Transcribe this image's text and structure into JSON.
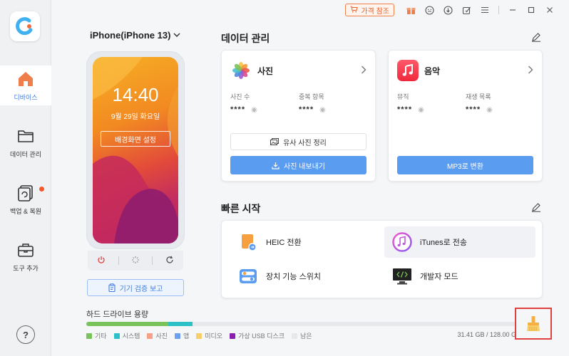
{
  "titlebar": {
    "price_label": "가격 참조"
  },
  "sidebar": {
    "items": [
      {
        "label": "디바이스",
        "icon": "home-icon"
      },
      {
        "label": "데이터 관리",
        "icon": "folder-icon"
      },
      {
        "label": "백업 & 복원",
        "icon": "backup-restore-icon"
      },
      {
        "label": "도구 추가",
        "icon": "toolbox-icon"
      }
    ],
    "help_label": "?"
  },
  "device": {
    "name": "iPhone(iPhone 13)",
    "time": "14:40",
    "date": "9월 29일 화요일",
    "wallpaper_label": "배경화면 설정",
    "verify_label": "기기 검증 보고"
  },
  "data_management": {
    "title": "데이터 관리",
    "photos": {
      "title": "사진",
      "stat1_label": "사진 수",
      "stat1_value": "****",
      "stat2_label": "중복 항목",
      "stat2_value": "****",
      "btn_similar": "유사 사진 정리",
      "btn_export": "사진 내보내기"
    },
    "music": {
      "title": "음악",
      "stat1_label": "뮤직",
      "stat1_value": "****",
      "stat2_label": "재생 목록",
      "stat2_value": "****",
      "btn_convert": "MP3로 변환"
    }
  },
  "quick_start": {
    "title": "빠른 시작",
    "items": [
      {
        "label": "HEIC 전환"
      },
      {
        "label": "iTunes로 전송"
      },
      {
        "label": "장치 기능 스위치"
      },
      {
        "label": "개발자 모드"
      }
    ]
  },
  "storage": {
    "title": "하드 드라이브 용량",
    "capacity": "31.41 GB / 128.00 GB",
    "legend": [
      {
        "label": "기타",
        "color": "#7ac35a"
      },
      {
        "label": "시스템",
        "color": "#2cc1c7"
      },
      {
        "label": "사진",
        "color": "#f6a08a"
      },
      {
        "label": "앱",
        "color": "#6f9ff0"
      },
      {
        "label": "미디오",
        "color": "#f6cf6a"
      },
      {
        "label": "가상 USB 디스크",
        "color": "#8a1fb0"
      },
      {
        "label": "남은",
        "color": "#e6e8ec"
      }
    ],
    "segments": [
      {
        "name": "기타",
        "fraction": 0.188,
        "color": "#7ac35a"
      },
      {
        "name": "시스템",
        "fraction": 0.057,
        "color": "#2cc1c7"
      }
    ]
  }
}
